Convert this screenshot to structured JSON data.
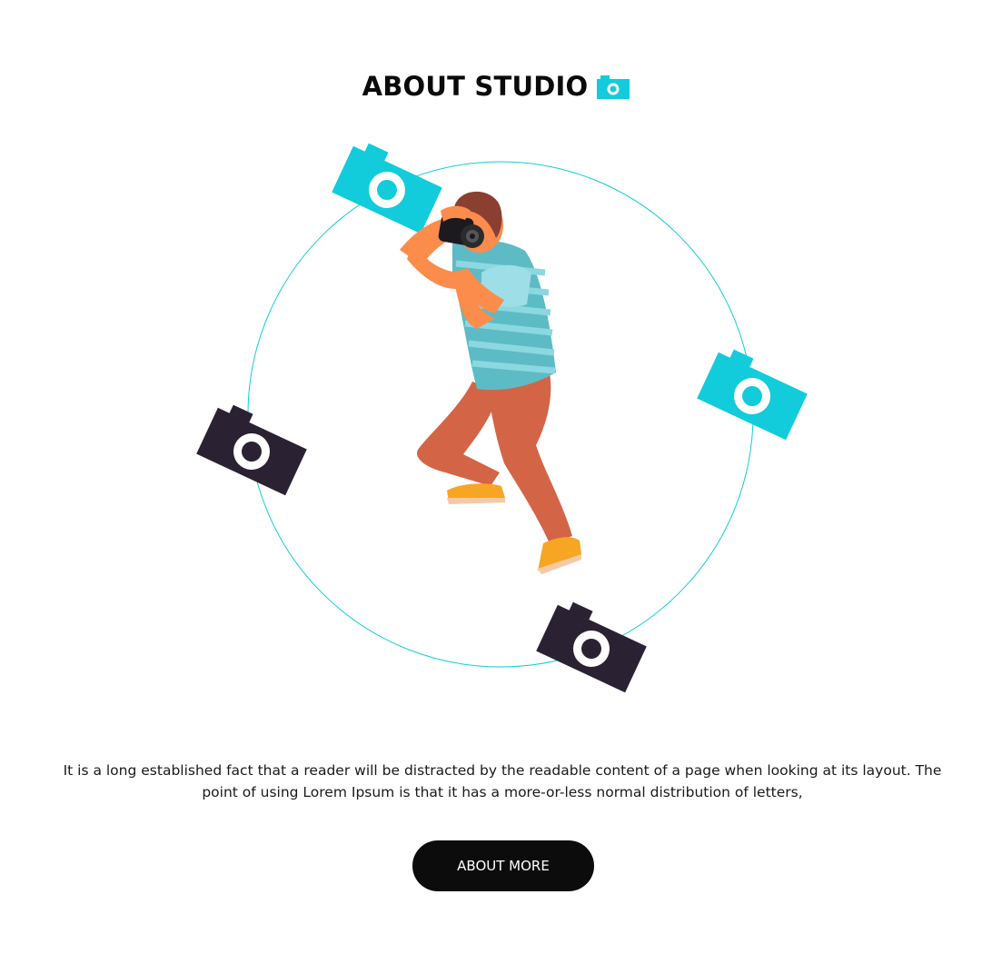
{
  "header": {
    "title": "ABOUT STUDIO",
    "title_icon": "camera-icon"
  },
  "illustration": {
    "subject": "photographer-illustration",
    "orbit_icons": [
      "camera-icon",
      "camera-icon",
      "camera-icon",
      "camera-icon"
    ],
    "colors": {
      "accent": "#12CCDB",
      "dark": "#2A2233",
      "ring": "#12CCDB"
    }
  },
  "content": {
    "description": "It is a long established fact that a reader will be distracted by the readable content of a page when looking at its layout. The point of using Lorem Ipsum is that it has a more-or-less normal distribution of letters,"
  },
  "cta": {
    "label": "ABOUT MORE"
  }
}
